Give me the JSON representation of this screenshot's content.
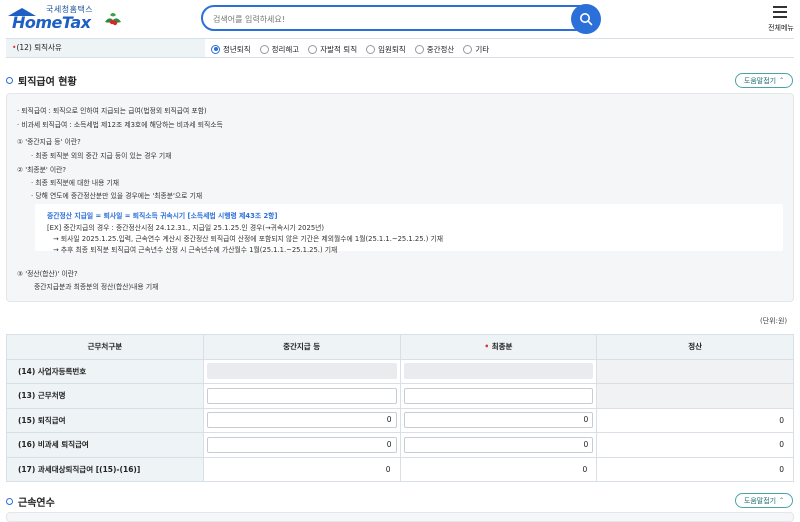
{
  "header": {
    "logo_small": "국세청홈택스",
    "logo_big": "HomeTax",
    "search_placeholder": "검색어를 입력하세요!",
    "menu_label": "전체메뉴"
  },
  "reason": {
    "label": "(12) 퇴직사유",
    "options": [
      "정년퇴직",
      "정리해고",
      "자발적 퇴직",
      "임원퇴직",
      "중간정산",
      "기타"
    ],
    "selected": "정년퇴직"
  },
  "section1": {
    "title": "퇴직급여 현황",
    "help_label": "도움말접기"
  },
  "info": {
    "line1": "퇴직급여 : 퇴직으로 인하여 지급되는 급여(법정외 퇴직급여 포함)",
    "line2": "비과세 퇴직급여 : 소득세법 제12조 제3호에 해당하는 비과세 퇴직소득",
    "q1": "① '중간지급 등' 이란?",
    "q1_a": "최종 퇴직분 외의 중간 지급 등이 있는 경우 기재",
    "q2": "② '최종분' 이란?",
    "q2_a1": "최종 퇴직분에 대한 내용 기재",
    "q2_a2": "당해 연도에 중간정산분만 있을 경우에는 '최종분'으로 기재",
    "box_title": "중간정산 지급일 = 퇴사일 = 퇴직소득 귀속시기 [소득세법 시행령 제43조 2항]",
    "box_ex": "[EX] 중간지급의 경우 : 중간정산시점 24.12.31., 지급일 25.1.25.인 경우(→귀속시기 2025년)",
    "box_l1": "→ 퇴사일 2025.1.25.입력, 근속연수 계산시 중간정산 퇴직급여 산정에 포함되지 않은 기간은 제외월수에 1월(25.1.1.~25.1.25.) 기재",
    "box_l2": "→ 추후 최종 퇴직분 퇴직급여 근속년수 산정 시 근속년수에 가산월수 1월(25.1.1.~25.1.25.) 기재",
    "q3": "③ '정산(합산)' 이란?",
    "q3_a": "중간지급분과 최종분의 정산(합산)내용 기재"
  },
  "unit": "(단위:원)",
  "table": {
    "headers": [
      "근무처구분",
      "중간지급 등",
      "최종분",
      "정산"
    ],
    "rows": [
      {
        "label": "(14) 사업자등록번호",
        "mid": "",
        "final": "",
        "total": ""
      },
      {
        "label": "(13) 근무처명",
        "mid": "",
        "final": "",
        "total": ""
      },
      {
        "label": "(15) 퇴직급여",
        "mid": "0",
        "final": "0",
        "total": "0"
      },
      {
        "label": "(16) 비과세 퇴직급여",
        "mid": "0",
        "final": "0",
        "total": "0"
      },
      {
        "label": "(17) 과세대상퇴직급여 [(15)-(16)]",
        "mid": "0",
        "final": "0",
        "total": "0"
      }
    ]
  },
  "section2": {
    "title": "근속연수",
    "help_label": "도움말접기"
  },
  "colors": {
    "accent": "#2b6fd8",
    "header_bg": "#eef3f6",
    "required": "#e03030",
    "help_border": "#4aa3a8"
  }
}
